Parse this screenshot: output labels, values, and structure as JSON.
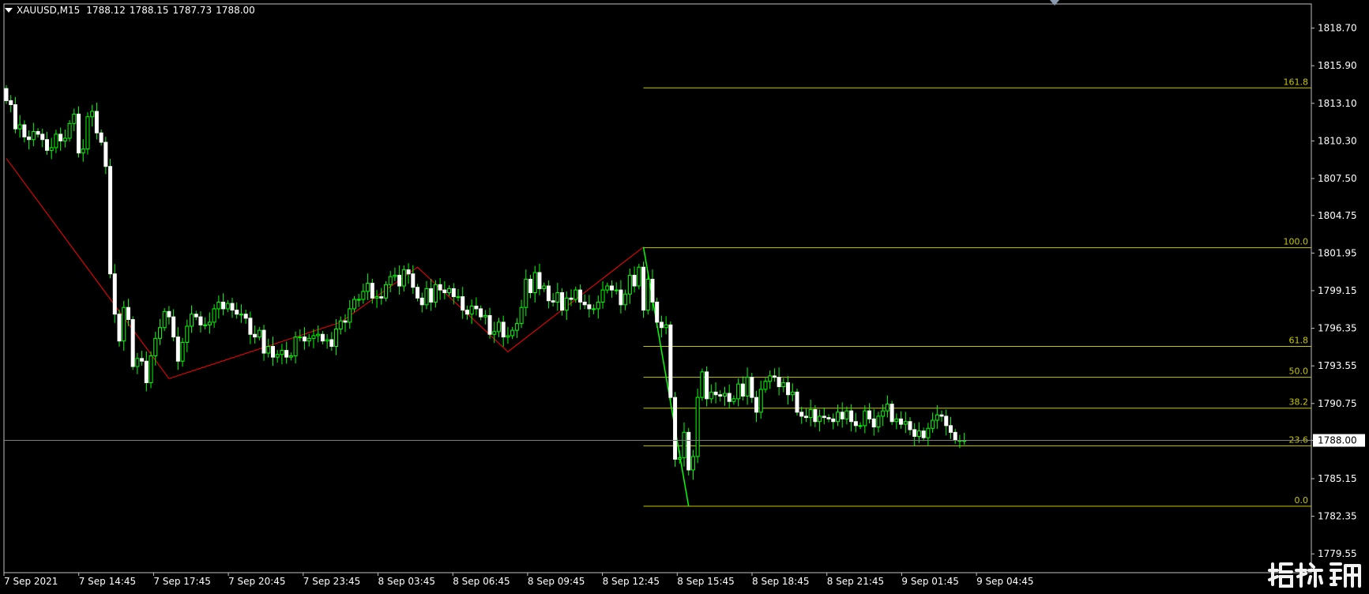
{
  "window": {
    "symbol": "XAUUSD,M15",
    "open": "1788.12",
    "high": "1788.15",
    "low": "1787.73",
    "close": "1788.00"
  },
  "price_axis": {
    "min": 1778.15,
    "max": 1820.5,
    "labels": [
      "1818.70",
      "1815.90",
      "1813.10",
      "1810.30",
      "1807.50",
      "1804.75",
      "1801.95",
      "1799.15",
      "1796.35",
      "1793.55",
      "1790.75",
      "1788.00",
      "1785.15",
      "1782.35",
      "1779.55"
    ],
    "current_price": "1788.00"
  },
  "time_axis": {
    "labels": [
      "7 Sep 2021",
      "7 Sep 14:45",
      "7 Sep 17:45",
      "7 Sep 20:45",
      "7 Sep 23:45",
      "8 Sep 03:45",
      "8 Sep 06:45",
      "8 Sep 09:45",
      "8 Sep 12:45",
      "8 Sep 15:45",
      "8 Sep 18:45",
      "8 Sep 21:45",
      "9 Sep 01:45",
      "9 Sep 04:45"
    ]
  },
  "fibonacci": {
    "levels": [
      {
        "label": "161.8",
        "price": 1814.25
      },
      {
        "label": "100.0",
        "price": 1802.35
      },
      {
        "label": "61.8",
        "price": 1795.0
      },
      {
        "label": "50.0",
        "price": 1792.7
      },
      {
        "label": "38.2",
        "price": 1790.4
      },
      {
        "label": "23.6",
        "price": 1787.6
      },
      {
        "label": "0.0",
        "price": 1783.1
      }
    ],
    "color": "#c8c800"
  },
  "zigzag": {
    "color": "#ff0000",
    "points": [
      [
        0,
        1809.0
      ],
      [
        36,
        1792.6
      ],
      [
        74,
        1796.8
      ],
      [
        91,
        1800.9
      ],
      [
        111,
        1794.6
      ],
      [
        141,
        1802.4
      ]
    ]
  },
  "impulse_line": {
    "color": "#00ff00",
    "points": [
      [
        141,
        1802.4
      ],
      [
        151,
        1783.1
      ]
    ]
  },
  "candle_closes": [
    1813.3,
    1813.0,
    1811.2,
    1811.5,
    1810.6,
    1810.4,
    1811.0,
    1810.8,
    1810.4,
    1809.6,
    1809.8,
    1810.8,
    1810.3,
    1810.5,
    1811.6,
    1812.3,
    1809.4,
    1809.7,
    1812.1,
    1812.5,
    1810.9,
    1810.2,
    1808.4,
    1800.4,
    1797.4,
    1795.4,
    1797.9,
    1797.0,
    1793.5,
    1794.1,
    1793.9,
    1792.3,
    1794.3,
    1795.6,
    1796.4,
    1797.6,
    1797.2,
    1795.7,
    1793.9,
    1795.3,
    1796.5,
    1797.4,
    1797.2,
    1796.6,
    1796.6,
    1796.8,
    1797.8,
    1798.3,
    1797.8,
    1798.2,
    1797.7,
    1797.4,
    1797.4,
    1797.1,
    1795.9,
    1795.7,
    1796.2,
    1794.5,
    1795.0,
    1794.2,
    1794.4,
    1794.7,
    1794.2,
    1794.3,
    1795.7,
    1795.7,
    1795.4,
    1795.6,
    1795.8,
    1795.9,
    1795.4,
    1795.5,
    1795.0,
    1796.3,
    1796.9,
    1796.8,
    1797.8,
    1798.5,
    1798.5,
    1799.1,
    1799.7,
    1798.6,
    1798.7,
    1798.6,
    1799.6,
    1800.2,
    1800.3,
    1799.5,
    1800.7,
    1800.4,
    1799.4,
    1798.6,
    1798.1,
    1799.3,
    1798.3,
    1799.6,
    1799.2,
    1799.0,
    1799.3,
    1798.7,
    1798.7,
    1797.7,
    1797.4,
    1798.0,
    1797.8,
    1797.2,
    1797.3,
    1795.9,
    1796.1,
    1796.8,
    1795.7,
    1795.8,
    1796.2,
    1796.7,
    1797.9,
    1800.0,
    1799.0,
    1800.5,
    1799.3,
    1799.5,
    1798.4,
    1798.3,
    1799.0,
    1797.7,
    1798.6,
    1798.5,
    1799.2,
    1798.3,
    1798.1,
    1797.8,
    1797.8,
    1798.3,
    1799.2,
    1799.5,
    1799.2,
    1799.2,
    1798.1,
    1798.9,
    1800.3,
    1799.5,
    1800.9,
    1797.7,
    1800.0,
    1798.3,
    1796.8,
    1796.4,
    1796.6,
    1791.2,
    1786.6,
    1786.7,
    1788.6,
    1785.8,
    1786.8,
    1791.2,
    1793.1,
    1791.1,
    1791.6,
    1791.4,
    1791.3,
    1791.5,
    1790.9,
    1791.1,
    1792.2,
    1791.3,
    1792.7,
    1791.2,
    1790.1,
    1791.8,
    1792.4,
    1792.8,
    1792.7,
    1792.0,
    1792.3,
    1791.4,
    1791.6,
    1790.1,
    1789.8,
    1789.7,
    1790.3,
    1789.4,
    1789.8,
    1789.7,
    1789.6,
    1789.4,
    1790.1,
    1789.6,
    1790.2,
    1789.4,
    1789.1,
    1789.1,
    1790.2,
    1789.6,
    1789.0,
    1789.8,
    1790.2,
    1790.7,
    1789.4,
    1789.6,
    1789.2,
    1789.4,
    1788.8,
    1788.3,
    1788.7,
    1788.2,
    1788.9,
    1789.5,
    1789.9,
    1789.8,
    1789.1,
    1788.6,
    1788.0,
    1788.0,
    1788.0
  ]
}
